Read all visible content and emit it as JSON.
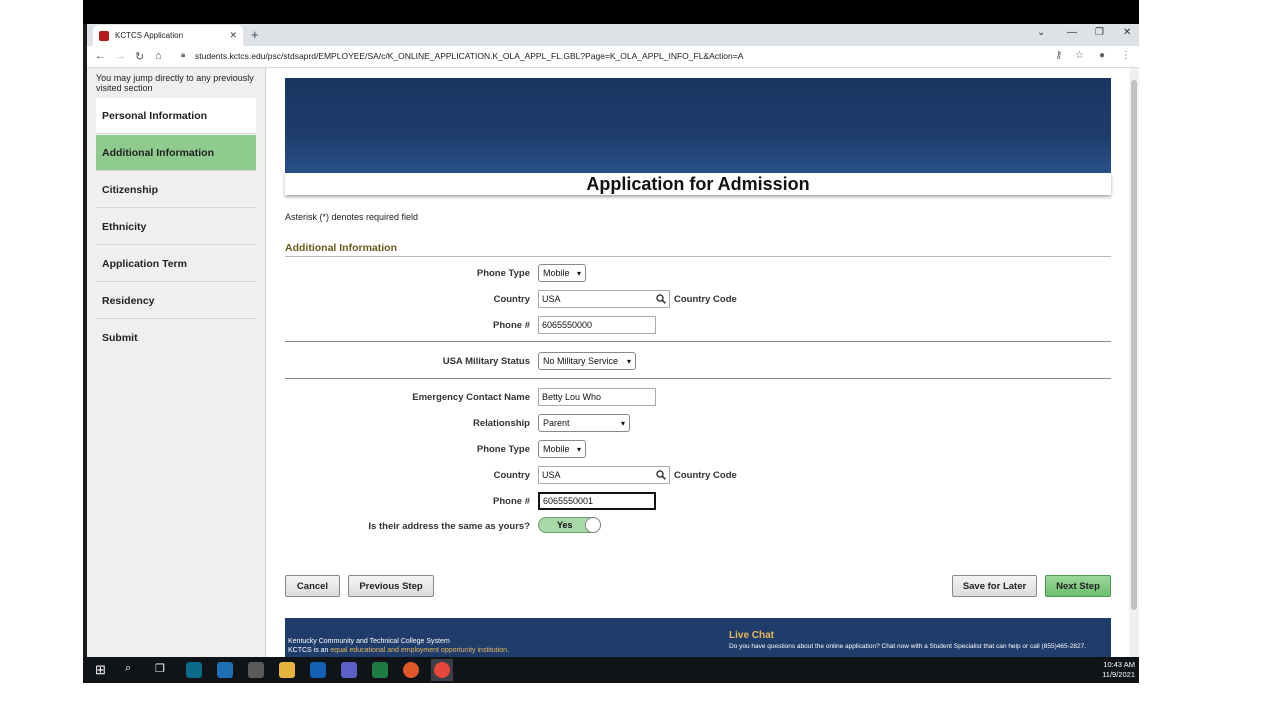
{
  "browser": {
    "tab_title": "KCTCS Application",
    "url": "students.kctcs.edu/psc/stdsaprd/EMPLOYEE/SA/c/K_ONLINE_APPLICATION.K_OLA_APPL_FL.GBL?Page=K_OLA_APPL_INFO_FL&Action=A"
  },
  "sidebar": {
    "jump_text": "You may jump directly to any previously visited section",
    "items": [
      {
        "label": "Personal Information"
      },
      {
        "label": "Additional Information"
      },
      {
        "label": "Citizenship"
      },
      {
        "label": "Ethnicity"
      },
      {
        "label": "Application Term"
      },
      {
        "label": "Residency"
      },
      {
        "label": "Submit"
      }
    ]
  },
  "page": {
    "title": "Application for Admission",
    "required_note": "Asterisk (*) denotes required field",
    "section_title": "Additional Information"
  },
  "form": {
    "phone_type_label": "Phone Type",
    "phone_type_value": "Mobile",
    "country_label": "Country",
    "country_value": "USA",
    "country_code_label": "Country Code",
    "phone_label": "Phone #",
    "phone_value": "6065550000",
    "military_label": "USA Military Status",
    "military_value": "No Military Service",
    "emergency_name_label": "Emergency Contact Name",
    "emergency_name_value": "Betty Lou Who",
    "relationship_label": "Relationship",
    "relationship_value": "Parent",
    "ec_phone_type_label": "Phone Type",
    "ec_phone_type_value": "Mobile",
    "ec_country_label": "Country",
    "ec_country_value": "USA",
    "ec_country_code_label": "Country Code",
    "ec_phone_label": "Phone #",
    "ec_phone_value": "6065550001",
    "same_address_label": "Is their address the same as yours?",
    "same_address_value": "Yes"
  },
  "buttons": {
    "cancel": "Cancel",
    "previous": "Previous Step",
    "save_later": "Save for Later",
    "next": "Next Step"
  },
  "footer": {
    "org": "Kentucky Community and Technical College System",
    "eeo_prefix": "KCTCS is an ",
    "eeo_link": "equal educational and employment opportunity institution.",
    "live_chat_title": "Live Chat",
    "live_chat_text": "Do you have questions about the online application? Chat now with a Student Specialist that can help or call (855)465-2827."
  },
  "taskbar": {
    "time": "10:43 AM",
    "date": "11/9/2021"
  }
}
